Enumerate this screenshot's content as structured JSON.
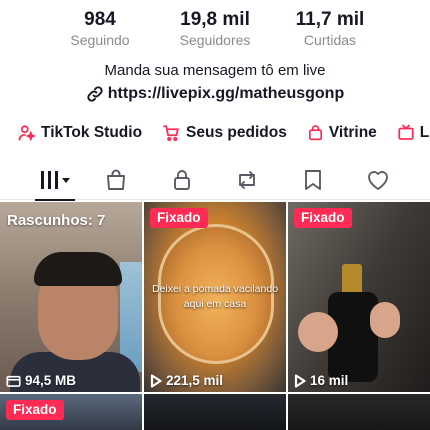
{
  "stats": [
    {
      "value": "984",
      "label": "Seguindo"
    },
    {
      "value": "19,8 mil",
      "label": "Seguidores"
    },
    {
      "value": "11,7 mil",
      "label": "Curtidas"
    }
  ],
  "bio": {
    "text": "Manda sua mensagem tô em live",
    "link": "https://livepix.gg/matheusgonp"
  },
  "shortcuts": [
    {
      "label": "TikTok Studio",
      "icon": "person-sparkle-icon"
    },
    {
      "label": "Seus pedidos",
      "icon": "cart-icon"
    },
    {
      "label": "Vitrine",
      "icon": "shopping-bag-icon"
    },
    {
      "label": "L",
      "icon": "tv-icon"
    }
  ],
  "tabs": [
    {
      "icon": "grid-videos-icon",
      "active": true
    },
    {
      "icon": "shop-bag-icon"
    },
    {
      "icon": "lock-icon"
    },
    {
      "icon": "repost-icon"
    },
    {
      "icon": "bookmark-icon"
    },
    {
      "icon": "heart-icon"
    }
  ],
  "videos": [
    {
      "label": "Rascunhos: 7",
      "meta": "94,5 MB",
      "meta_icon": "folder-icon"
    },
    {
      "badge": "Fixado",
      "caption": "Deixei a pomada vacilando aqui em casa",
      "meta": "221,5 mil",
      "meta_icon": "play-icon"
    },
    {
      "badge": "Fixado",
      "meta": "16 mil",
      "meta_icon": "play-icon"
    },
    {
      "badge": "Fixado"
    }
  ],
  "colors": {
    "accent": "#fe2c55",
    "text": "#161823",
    "muted": "#8a8b91"
  }
}
